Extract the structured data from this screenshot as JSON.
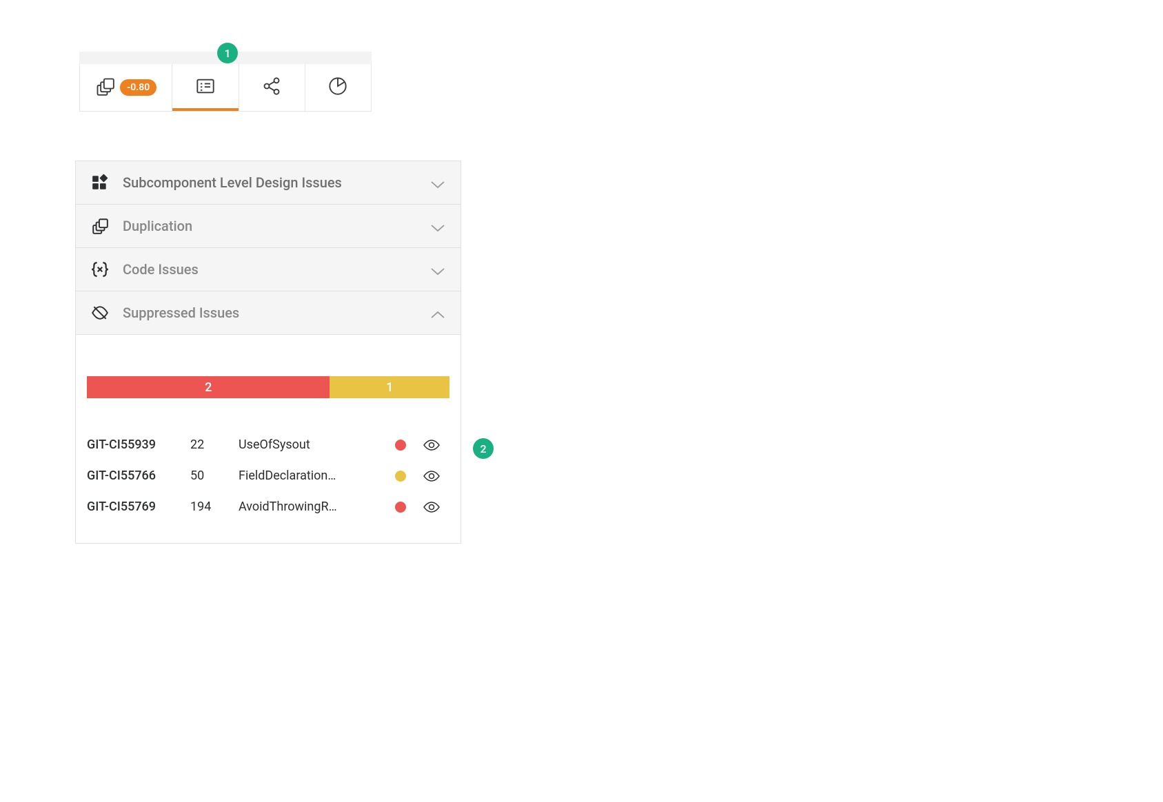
{
  "colors": {
    "red": "#ed5553",
    "yellow": "#e9c444",
    "green": "#1bb082",
    "orange": "#ed8120"
  },
  "annotations": {
    "a1": "1",
    "a2": "2"
  },
  "tabs": {
    "badge": "-0.80"
  },
  "accordion": [
    {
      "label": "Subcomponent Level Design Issues",
      "expanded": false
    },
    {
      "label": "Duplication",
      "expanded": false
    },
    {
      "label": "Code Issues",
      "expanded": false
    },
    {
      "label": "Suppressed Issues",
      "expanded": true
    }
  ],
  "distribution": [
    {
      "count": "2",
      "color": "red",
      "pct": 67
    },
    {
      "count": "1",
      "color": "yellow",
      "pct": 33
    }
  ],
  "issues": [
    {
      "id": "GIT-CI55939",
      "line": "22",
      "name": "UseOfSysout",
      "severity": "red"
    },
    {
      "id": "GIT-CI55766",
      "line": "50",
      "name": "FieldDeclaration…",
      "severity": "yellow"
    },
    {
      "id": "GIT-CI55769",
      "line": "194",
      "name": "AvoidThrowingR…",
      "severity": "red"
    }
  ]
}
